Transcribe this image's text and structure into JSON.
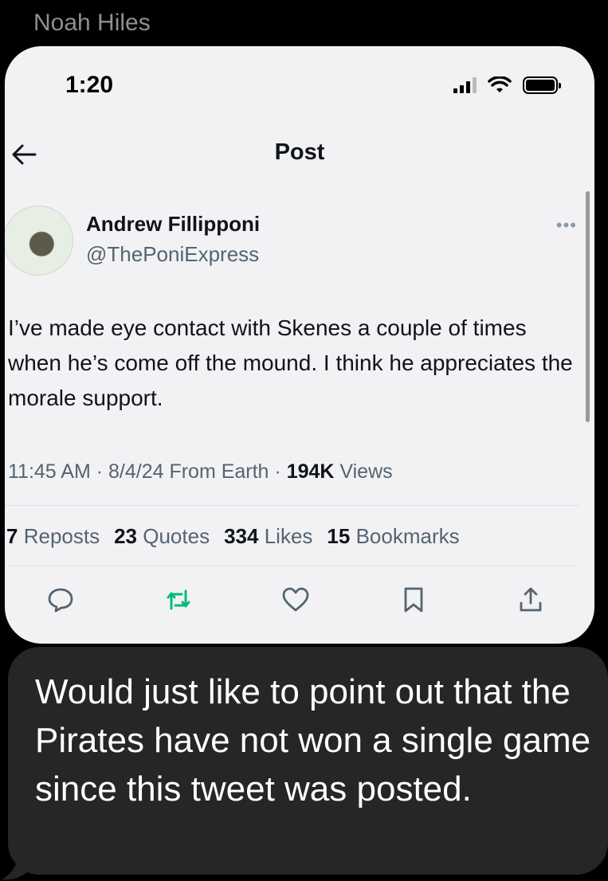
{
  "conversation": {
    "sender_name": "Noah Hiles",
    "message_text": "Would just like to point out that the Pirates have not won a single game since this tweet was posted."
  },
  "screenshot": {
    "status_time": "1:20",
    "header_title": "Post",
    "author": {
      "name": "Andrew Fillipponi",
      "handle": "@ThePoniExpress"
    },
    "tweet_text": "I’ve made eye contact with Skenes a couple of times when he’s come off the mound. I think he appreciates the morale support.",
    "meta": {
      "time_date": "11:45 AM · 8/4/24 From Earth · ",
      "views_count": "194K",
      "views_label": " Views"
    },
    "stats": {
      "reposts_count": "7",
      "reposts_label": "Reposts",
      "quotes_count": "23",
      "quotes_label": "Quotes",
      "likes_count": "334",
      "likes_label": "Likes",
      "bookmarks_count": "15",
      "bookmarks_label": "Bookmarks"
    },
    "actions": [
      "reply-icon",
      "repost-icon",
      "like-icon",
      "bookmark-icon",
      "share-icon"
    ]
  },
  "colors": {
    "background": "#000000",
    "bubble": "#262628",
    "card": "#f2f2f4",
    "repost_green": "#00ba7c",
    "muted_text": "#536471"
  }
}
